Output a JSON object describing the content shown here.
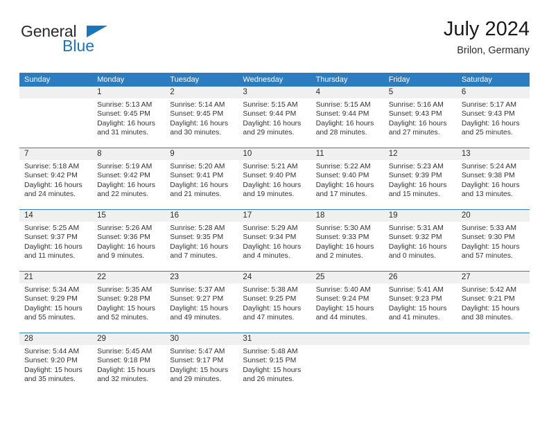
{
  "brand": {
    "name_top": "General",
    "name_bottom": "Blue",
    "triangle_color": "#1b75bb"
  },
  "header": {
    "title": "July 2024",
    "subtitle": "Brilon, Germany"
  },
  "theme": {
    "header_blue": "#2e7cc0",
    "band_gray": "#f0f0f0",
    "text_dark": "#2b2b2b"
  },
  "weekdays": [
    "Sunday",
    "Monday",
    "Tuesday",
    "Wednesday",
    "Thursday",
    "Friday",
    "Saturday"
  ],
  "weeks": [
    {
      "days": [
        {
          "date": "",
          "lines": []
        },
        {
          "date": "1",
          "lines": [
            "Sunrise: 5:13 AM",
            "Sunset: 9:45 PM",
            "Daylight: 16 hours",
            "and 31 minutes."
          ]
        },
        {
          "date": "2",
          "lines": [
            "Sunrise: 5:14 AM",
            "Sunset: 9:45 PM",
            "Daylight: 16 hours",
            "and 30 minutes."
          ]
        },
        {
          "date": "3",
          "lines": [
            "Sunrise: 5:15 AM",
            "Sunset: 9:44 PM",
            "Daylight: 16 hours",
            "and 29 minutes."
          ]
        },
        {
          "date": "4",
          "lines": [
            "Sunrise: 5:15 AM",
            "Sunset: 9:44 PM",
            "Daylight: 16 hours",
            "and 28 minutes."
          ]
        },
        {
          "date": "5",
          "lines": [
            "Sunrise: 5:16 AM",
            "Sunset: 9:43 PM",
            "Daylight: 16 hours",
            "and 27 minutes."
          ]
        },
        {
          "date": "6",
          "lines": [
            "Sunrise: 5:17 AM",
            "Sunset: 9:43 PM",
            "Daylight: 16 hours",
            "and 25 minutes."
          ]
        }
      ]
    },
    {
      "days": [
        {
          "date": "7",
          "lines": [
            "Sunrise: 5:18 AM",
            "Sunset: 9:42 PM",
            "Daylight: 16 hours",
            "and 24 minutes."
          ]
        },
        {
          "date": "8",
          "lines": [
            "Sunrise: 5:19 AM",
            "Sunset: 9:42 PM",
            "Daylight: 16 hours",
            "and 22 minutes."
          ]
        },
        {
          "date": "9",
          "lines": [
            "Sunrise: 5:20 AM",
            "Sunset: 9:41 PM",
            "Daylight: 16 hours",
            "and 21 minutes."
          ]
        },
        {
          "date": "10",
          "lines": [
            "Sunrise: 5:21 AM",
            "Sunset: 9:40 PM",
            "Daylight: 16 hours",
            "and 19 minutes."
          ]
        },
        {
          "date": "11",
          "lines": [
            "Sunrise: 5:22 AM",
            "Sunset: 9:40 PM",
            "Daylight: 16 hours",
            "and 17 minutes."
          ]
        },
        {
          "date": "12",
          "lines": [
            "Sunrise: 5:23 AM",
            "Sunset: 9:39 PM",
            "Daylight: 16 hours",
            "and 15 minutes."
          ]
        },
        {
          "date": "13",
          "lines": [
            "Sunrise: 5:24 AM",
            "Sunset: 9:38 PM",
            "Daylight: 16 hours",
            "and 13 minutes."
          ]
        }
      ]
    },
    {
      "days": [
        {
          "date": "14",
          "lines": [
            "Sunrise: 5:25 AM",
            "Sunset: 9:37 PM",
            "Daylight: 16 hours",
            "and 11 minutes."
          ]
        },
        {
          "date": "15",
          "lines": [
            "Sunrise: 5:26 AM",
            "Sunset: 9:36 PM",
            "Daylight: 16 hours",
            "and 9 minutes."
          ]
        },
        {
          "date": "16",
          "lines": [
            "Sunrise: 5:28 AM",
            "Sunset: 9:35 PM",
            "Daylight: 16 hours",
            "and 7 minutes."
          ]
        },
        {
          "date": "17",
          "lines": [
            "Sunrise: 5:29 AM",
            "Sunset: 9:34 PM",
            "Daylight: 16 hours",
            "and 4 minutes."
          ]
        },
        {
          "date": "18",
          "lines": [
            "Sunrise: 5:30 AM",
            "Sunset: 9:33 PM",
            "Daylight: 16 hours",
            "and 2 minutes."
          ]
        },
        {
          "date": "19",
          "lines": [
            "Sunrise: 5:31 AM",
            "Sunset: 9:32 PM",
            "Daylight: 16 hours",
            "and 0 minutes."
          ]
        },
        {
          "date": "20",
          "lines": [
            "Sunrise: 5:33 AM",
            "Sunset: 9:30 PM",
            "Daylight: 15 hours",
            "and 57 minutes."
          ]
        }
      ]
    },
    {
      "days": [
        {
          "date": "21",
          "lines": [
            "Sunrise: 5:34 AM",
            "Sunset: 9:29 PM",
            "Daylight: 15 hours",
            "and 55 minutes."
          ]
        },
        {
          "date": "22",
          "lines": [
            "Sunrise: 5:35 AM",
            "Sunset: 9:28 PM",
            "Daylight: 15 hours",
            "and 52 minutes."
          ]
        },
        {
          "date": "23",
          "lines": [
            "Sunrise: 5:37 AM",
            "Sunset: 9:27 PM",
            "Daylight: 15 hours",
            "and 49 minutes."
          ]
        },
        {
          "date": "24",
          "lines": [
            "Sunrise: 5:38 AM",
            "Sunset: 9:25 PM",
            "Daylight: 15 hours",
            "and 47 minutes."
          ]
        },
        {
          "date": "25",
          "lines": [
            "Sunrise: 5:40 AM",
            "Sunset: 9:24 PM",
            "Daylight: 15 hours",
            "and 44 minutes."
          ]
        },
        {
          "date": "26",
          "lines": [
            "Sunrise: 5:41 AM",
            "Sunset: 9:23 PM",
            "Daylight: 15 hours",
            "and 41 minutes."
          ]
        },
        {
          "date": "27",
          "lines": [
            "Sunrise: 5:42 AM",
            "Sunset: 9:21 PM",
            "Daylight: 15 hours",
            "and 38 minutes."
          ]
        }
      ]
    },
    {
      "days": [
        {
          "date": "28",
          "lines": [
            "Sunrise: 5:44 AM",
            "Sunset: 9:20 PM",
            "Daylight: 15 hours",
            "and 35 minutes."
          ]
        },
        {
          "date": "29",
          "lines": [
            "Sunrise: 5:45 AM",
            "Sunset: 9:18 PM",
            "Daylight: 15 hours",
            "and 32 minutes."
          ]
        },
        {
          "date": "30",
          "lines": [
            "Sunrise: 5:47 AM",
            "Sunset: 9:17 PM",
            "Daylight: 15 hours",
            "and 29 minutes."
          ]
        },
        {
          "date": "31",
          "lines": [
            "Sunrise: 5:48 AM",
            "Sunset: 9:15 PM",
            "Daylight: 15 hours",
            "and 26 minutes."
          ]
        },
        {
          "date": "",
          "lines": []
        },
        {
          "date": "",
          "lines": []
        },
        {
          "date": "",
          "lines": []
        }
      ]
    }
  ]
}
